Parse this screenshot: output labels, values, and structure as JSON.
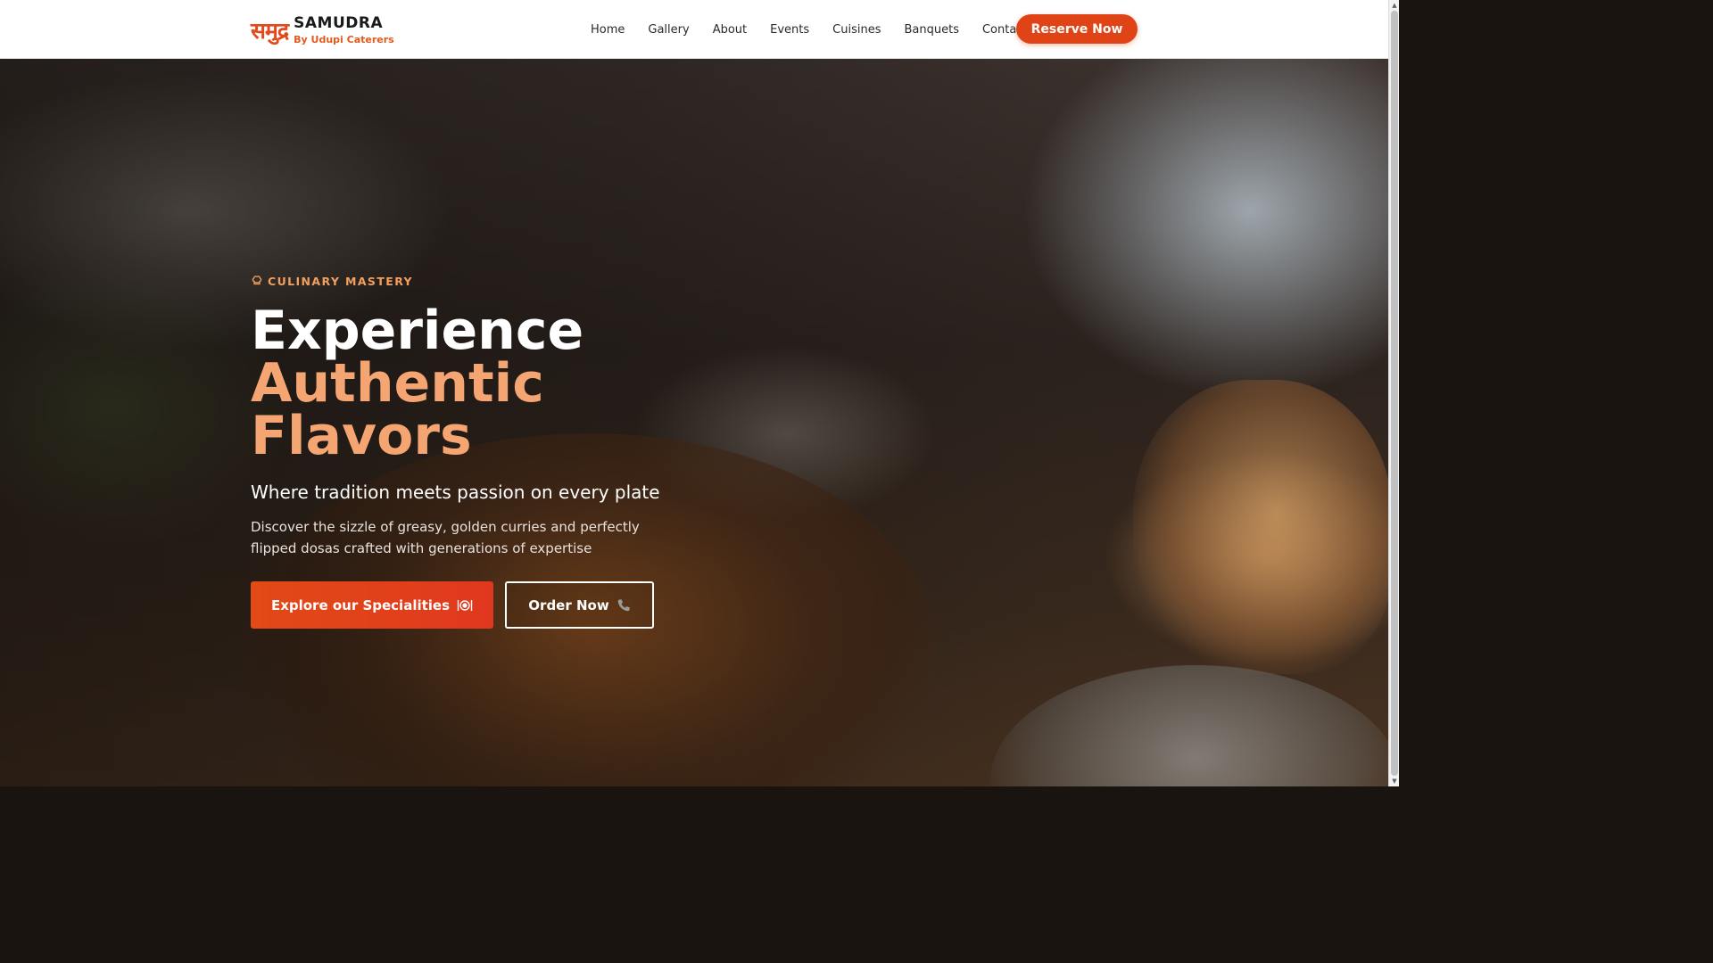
{
  "header": {
    "logo_devanagari": "समुद्र",
    "logo_name": "SAMUDRA",
    "logo_sub": "By Udupi Caterers",
    "nav": [
      {
        "label": "Home"
      },
      {
        "label": "Gallery"
      },
      {
        "label": "About"
      },
      {
        "label": "Events"
      },
      {
        "label": "Cuisines"
      },
      {
        "label": "Banquets"
      },
      {
        "label": "Contact"
      }
    ],
    "reserve_label": "Reserve Now"
  },
  "hero": {
    "eyebrow": "CULINARY MASTERY",
    "eyebrow_icon": "chef-hat-icon",
    "title_line1": "Experience",
    "title_line2": "Authentic",
    "title_line3": "Flavors",
    "subtitle": "Where tradition meets passion on every plate",
    "description": "Discover the sizzle of greasy, golden curries and perfectly flipped dosas crafted with generations of expertise",
    "primary_button": {
      "label": "Explore our Specialities",
      "icon": "plate-cutlery-icon"
    },
    "secondary_button": {
      "label": "Order Now",
      "icon": "phone-icon"
    }
  },
  "colors": {
    "accent": "#e04416",
    "highlight": "#f4a572",
    "eyebrow": "#f0a060"
  }
}
